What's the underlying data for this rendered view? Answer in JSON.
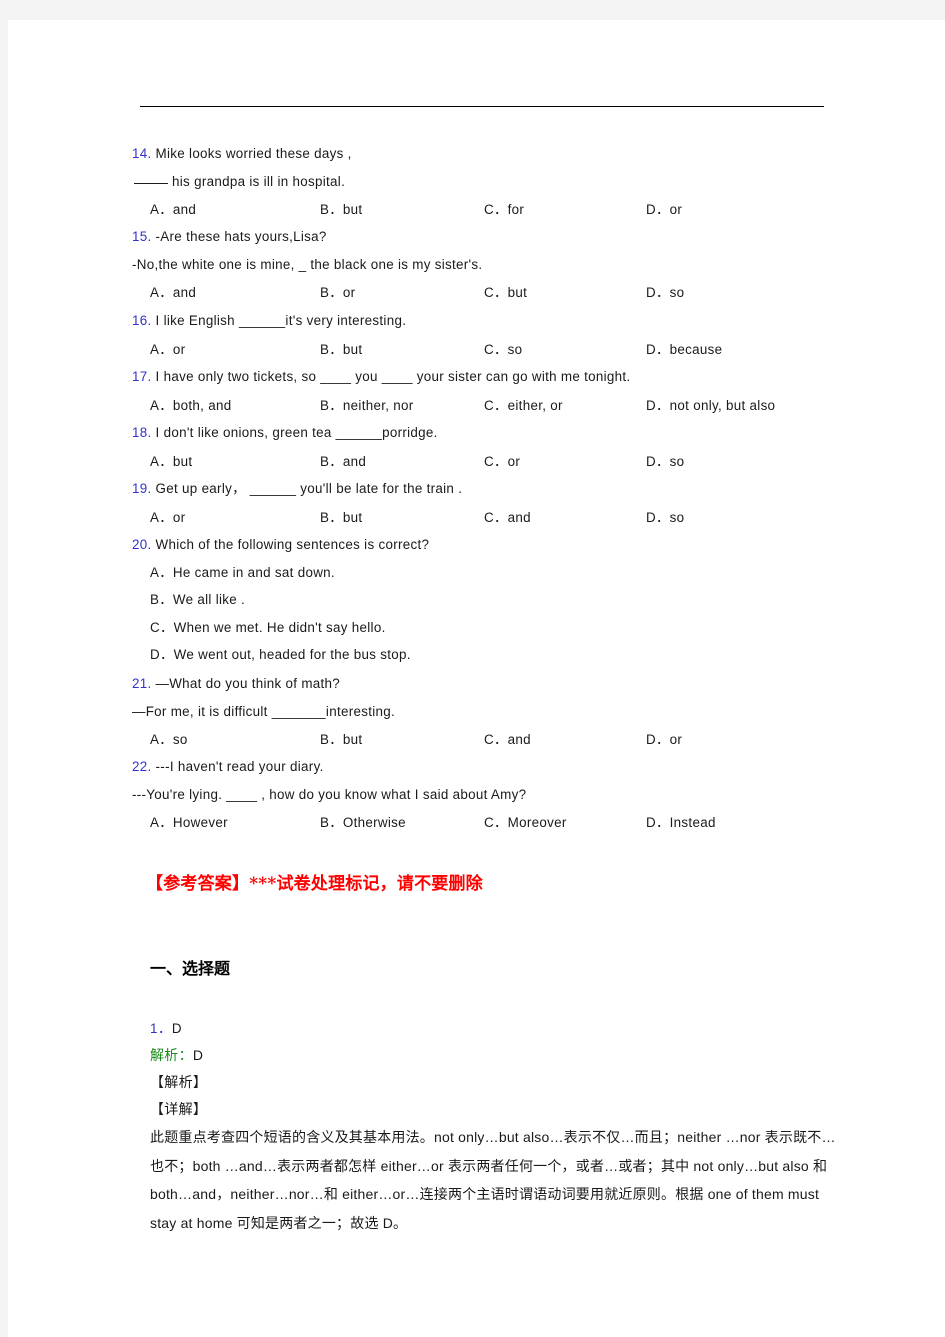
{
  "page": {
    "background": "#ffffff",
    "margin_color": "#f4f4f4",
    "accent_blue": "#3333cc",
    "accent_red": "#ff0000",
    "accent_green": "#1a8c1a",
    "body_color": "#1a1a1a"
  },
  "questions": [
    {
      "number": "14.",
      "lines": [
        "Mike  looks  worried  these  days ,",
        "his grandpa  is  ill  in  hospital."
      ],
      "options": [
        "A．and",
        "B．but",
        "C．for",
        "D．or"
      ]
    },
    {
      "number": "15.",
      "lines": [
        "-Are  these  hats  yours,Lisa?",
        "-No,the  white  one  is  mine,  _ the  black  one  is  my  sister's."
      ],
      "options": [
        "A．and",
        "B．or",
        "C．but",
        "D．so"
      ]
    },
    {
      "number": "16.",
      "lines": [
        "I like English ______it's very interesting."
      ],
      "options": [
        "A．or",
        "B．but",
        "C．so",
        "D．because"
      ]
    },
    {
      "number": "17.",
      "lines": [
        "I have only two tickets, so ____ you ____ your sister can go with me tonight."
      ],
      "options": [
        "A．both, and",
        "B．neither, nor",
        "C．either, or",
        "D．not only, but also"
      ]
    },
    {
      "number": "18.",
      "lines": [
        "I don't like onions, green tea ______porridge."
      ],
      "options": [
        "A．but",
        "B．and",
        "C．or",
        "D．so"
      ]
    },
    {
      "number": "19.",
      "lines": [
        "Get up early， ______ you'll be late for the train ."
      ],
      "options": [
        "A．or",
        "B．but",
        "C．and",
        "D．so"
      ]
    },
    {
      "number": "20.",
      "lines": [
        "Which of the following sentences is correct?"
      ],
      "stacked_options": [
        "A．He came in and sat down.",
        "B．We all like .",
        "C．When we met. He didn't say hello.",
        "D．We went out, headed for the bus stop."
      ]
    },
    {
      "number": "21.",
      "lines": [
        "—What do you think of math?",
        "—For me, it is difficult _______interesting."
      ],
      "options": [
        "A．so",
        "B．but",
        "C．and",
        "D．or"
      ]
    },
    {
      "number": "22.",
      "lines": [
        "---I haven't read your diary.",
        "---You're lying. ____   , how do you know what I said about Amy?"
      ],
      "options": [
        "A．However",
        "B．Otherwise",
        "C．Moreover",
        "D．Instead"
      ]
    }
  ],
  "notice": "【参考答案】***试卷处理标记，请不要删除",
  "section_heading": "一、选择题",
  "answer": {
    "number": "1．",
    "letter": "D",
    "parse_label": "解析：",
    "parse_letter": "D",
    "tag_analysis": "【解析】",
    "tag_detail": "【详解】",
    "explanation": "此题重点考查四个短语的含义及其基本用法。not only…but also…表示不仅…而且；neither …nor 表示既不…也不；both …and…表示两者都怎样 either…or 表示两者任何一个，或者…或者；其中 not only…but also 和 both…and，neither…nor…和 either…or…连接两个主语时谓语动词要用就近原则。根据 one of them must stay at home 可知是两者之一；故选 D。"
  }
}
